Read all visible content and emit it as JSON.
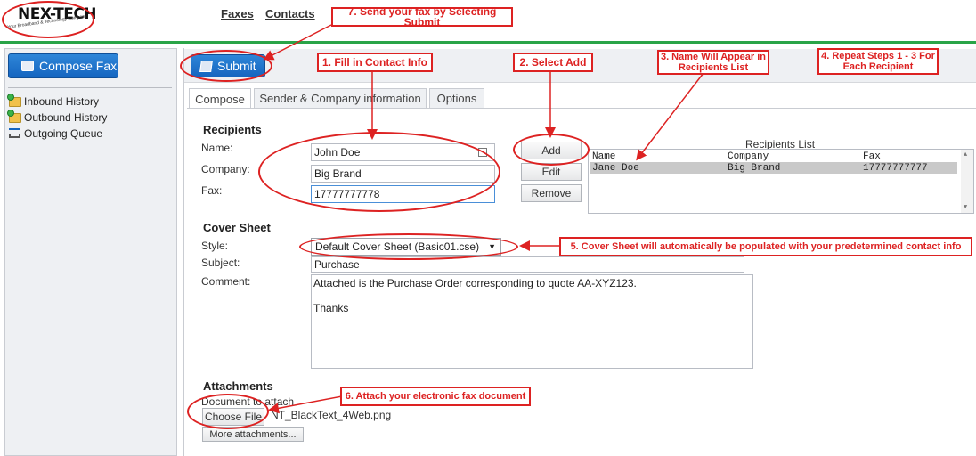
{
  "header": {
    "logo_text": "NEX-TECH",
    "logo_tagline": "Your Broadband & Technology Company",
    "nav": [
      "Faxes",
      "Contacts"
    ]
  },
  "sidebar": {
    "compose_label": "Compose Fax",
    "items": [
      {
        "label": "Inbound History",
        "icon": "inbound-folder-icon"
      },
      {
        "label": "Outbound History",
        "icon": "outbound-folder-icon"
      },
      {
        "label": "Outgoing Queue",
        "icon": "queue-icon"
      }
    ]
  },
  "toolbar": {
    "submit_label": "Submit"
  },
  "tabs": [
    "Compose",
    "Sender & Company information",
    "Options"
  ],
  "recipients": {
    "title": "Recipients",
    "name_label": "Name:",
    "company_label": "Company:",
    "fax_label": "Fax:",
    "name_value": "John Doe",
    "company_value": "Big Brand",
    "fax_value": "17777777778",
    "add_label": "Add",
    "edit_label": "Edit",
    "remove_label": "Remove",
    "list_title": "Recipients List",
    "columns": [
      "Name",
      "Company",
      "Fax"
    ],
    "rows": [
      [
        "Jane Doe",
        "Big Brand",
        "17777777777"
      ]
    ]
  },
  "cover_sheet": {
    "title": "Cover Sheet",
    "style_label": "Style:",
    "subject_label": "Subject:",
    "comment_label": "Comment:",
    "style_value": "Default Cover Sheet (Basic01.cse)",
    "subject_value": "Purchase",
    "comment_value": "Attached is the Purchase Order corresponding to quote AA-XYZ123.\n\nThanks"
  },
  "attachments": {
    "title": "Attachments",
    "doc_label": "Document to attach",
    "choose_label": "Choose File",
    "file_name": "NT_BlackText_4Web.png",
    "more_label": "More attachments..."
  },
  "annotations": {
    "step1": "1. Fill in Contact Info",
    "step2": "2. Select Add",
    "step3": "3. Name Will Appear in Recipients List",
    "step4": "4. Repeat Steps 1 - 3 For Each Recipient",
    "step5": "5. Cover Sheet will automatically be populated with your predetermined contact info",
    "step6": "6. Attach your electronic fax document",
    "step7": "7. Send your fax by Selecting Submit"
  },
  "colors": {
    "accent": "#1565c0",
    "annotation": "#dd2222",
    "brand_bar": "#2aa448"
  }
}
